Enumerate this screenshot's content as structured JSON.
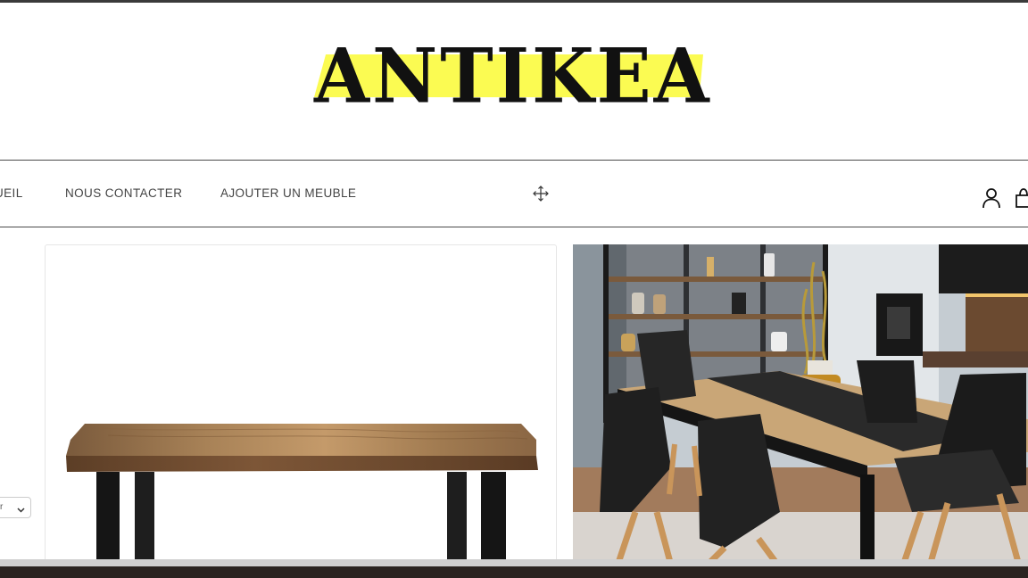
{
  "header": {
    "logo_text": "ANTIKEA"
  },
  "nav": {
    "links": [
      {
        "label": "UEIL"
      },
      {
        "label": "NOUS CONTACTER"
      },
      {
        "label": "AJOUTER UN MEUBLE"
      }
    ],
    "icons": [
      "move-icon",
      "user-icon",
      "shopping-bag-icon"
    ]
  },
  "sidebar": {
    "sort_label": "r"
  },
  "colors": {
    "logo_highlight": "#fbfb52",
    "text": "#444444",
    "border": "#4a4a4a"
  }
}
